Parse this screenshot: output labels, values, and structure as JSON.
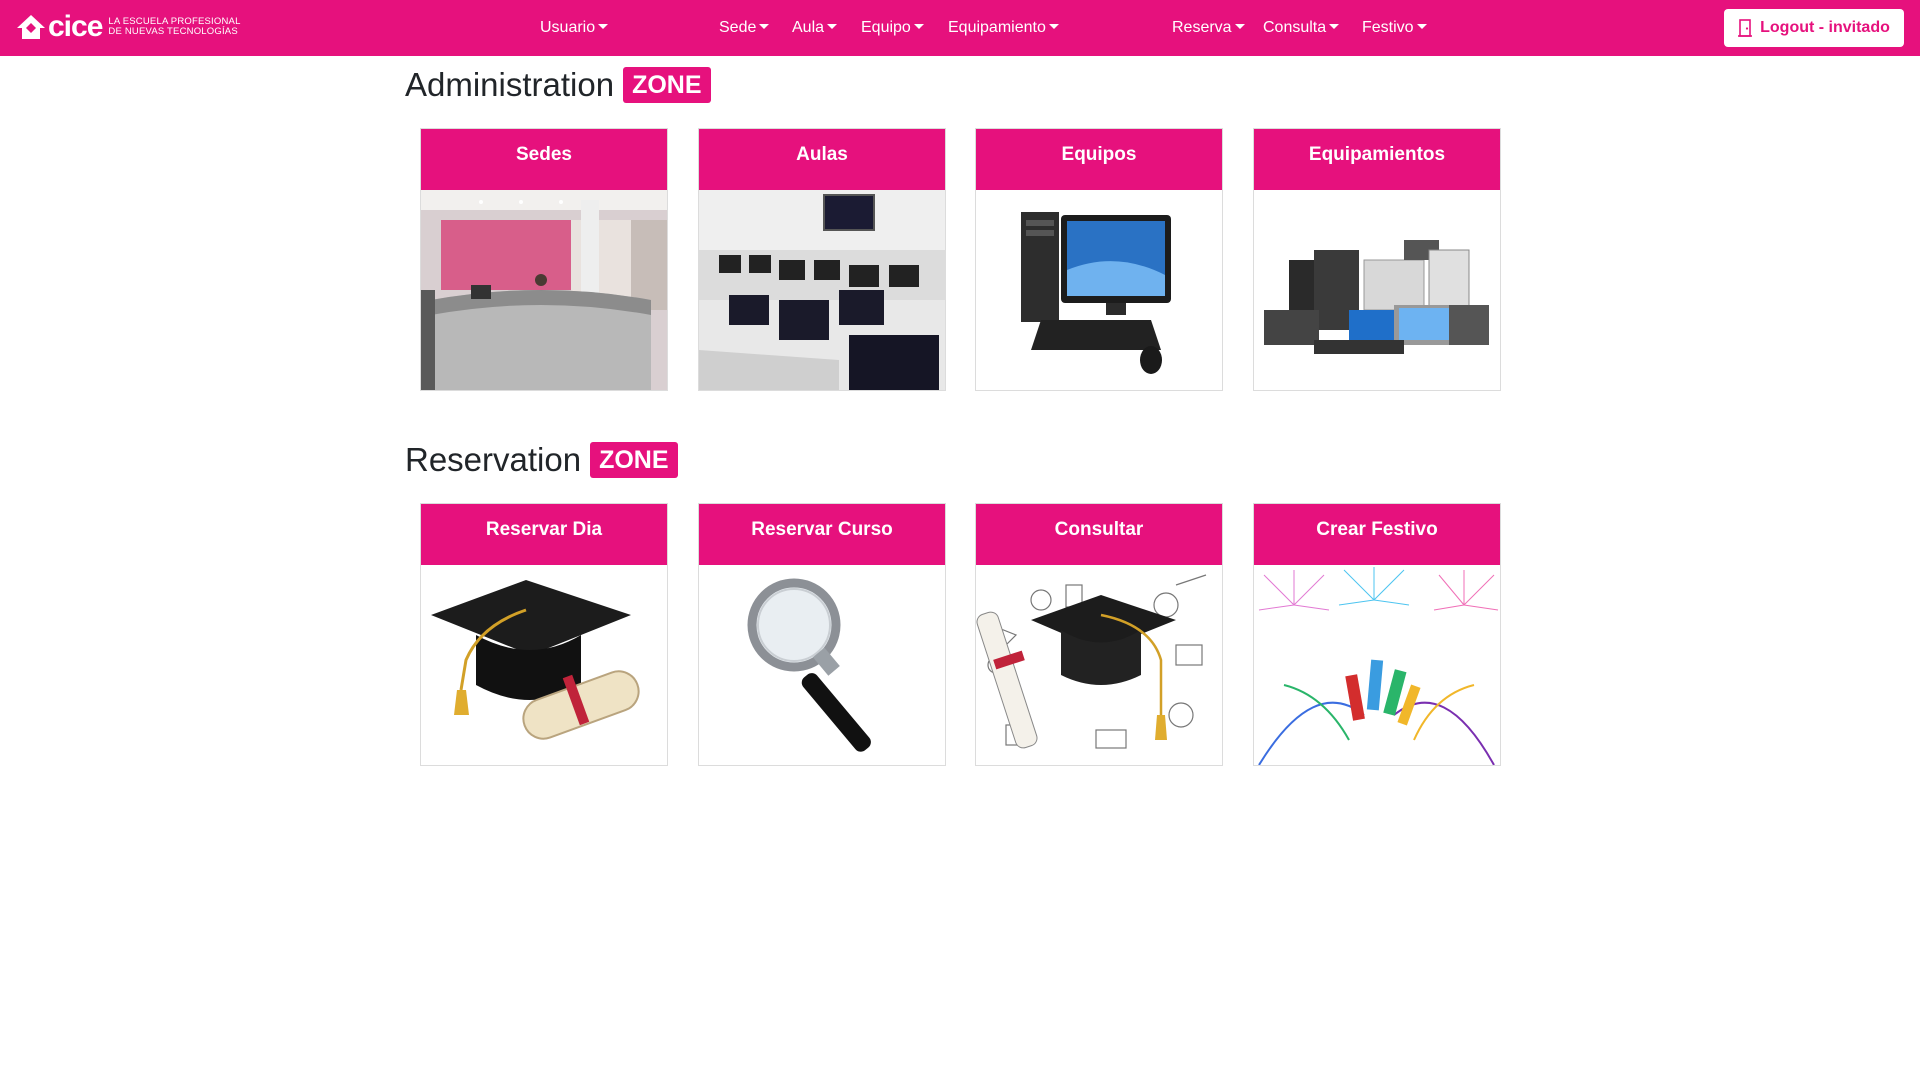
{
  "brand": {
    "logo_text": "cice",
    "tagline_line1": "LA ESCUELA PROFESIONAL",
    "tagline_line2": "DE NUEVAS TECNOLOGÍAS"
  },
  "nav": {
    "usuario": "Usuario",
    "sede": "Sede",
    "aula": "Aula",
    "equipo": "Equipo",
    "equipamiento": "Equipamiento",
    "reserva": "Reserva",
    "consulta": "Consulta",
    "festivo": "Festivo",
    "logout": "Logout - invitado"
  },
  "admin": {
    "heading": "Administration",
    "badge": "ZONE",
    "cards": [
      "Sedes",
      "Aulas",
      "Equipos",
      "Equipamientos"
    ]
  },
  "reservation": {
    "heading": "Reservation",
    "badge": "ZONE",
    "cards": [
      "Reservar Dia",
      "Reservar Curso",
      "Consultar",
      "Crear Festivo"
    ]
  },
  "colors": {
    "brand_pink": "#e6117d",
    "text_dark": "#212529",
    "card_border": "#dcdcdc"
  }
}
